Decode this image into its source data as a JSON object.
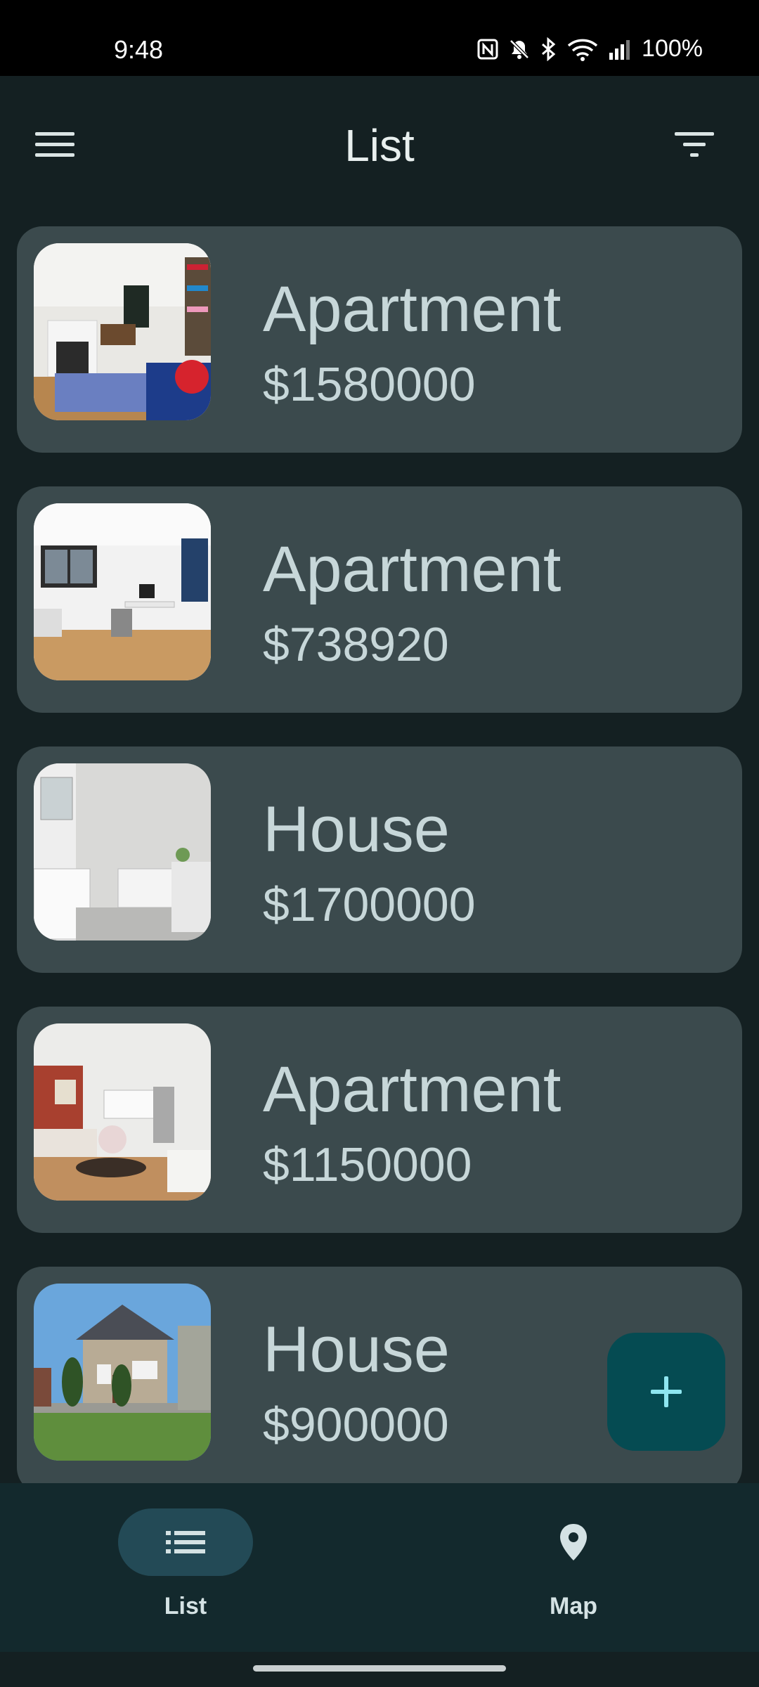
{
  "status_bar": {
    "time": "9:48",
    "battery": "100%"
  },
  "app_bar": {
    "title": "List",
    "menu_icon": "menu-icon",
    "filter_icon": "filter-icon"
  },
  "listings": [
    {
      "type": "Apartment",
      "price": "$1580000",
      "photo": "living-room-with-fireplace"
    },
    {
      "type": "Apartment",
      "price": "$738920",
      "photo": "living-room-with-desk"
    },
    {
      "type": "House",
      "price": "$1700000",
      "photo": "bathroom-with-bathtub"
    },
    {
      "type": "Apartment",
      "price": "$1150000",
      "photo": "open-kitchen-living-room"
    },
    {
      "type": "House",
      "price": "$900000",
      "photo": "house-exterior"
    }
  ],
  "fab": {
    "icon": "plus-icon"
  },
  "bottom_nav": [
    {
      "label": "List",
      "icon": "list-icon",
      "selected": true
    },
    {
      "label": "Map",
      "icon": "map-pin-icon",
      "selected": false
    }
  ],
  "colors": {
    "background": "#142022",
    "card": "#3b4a4d",
    "fab": "#054b52",
    "nav": "#13292d",
    "accent": "#8ee6f0"
  }
}
